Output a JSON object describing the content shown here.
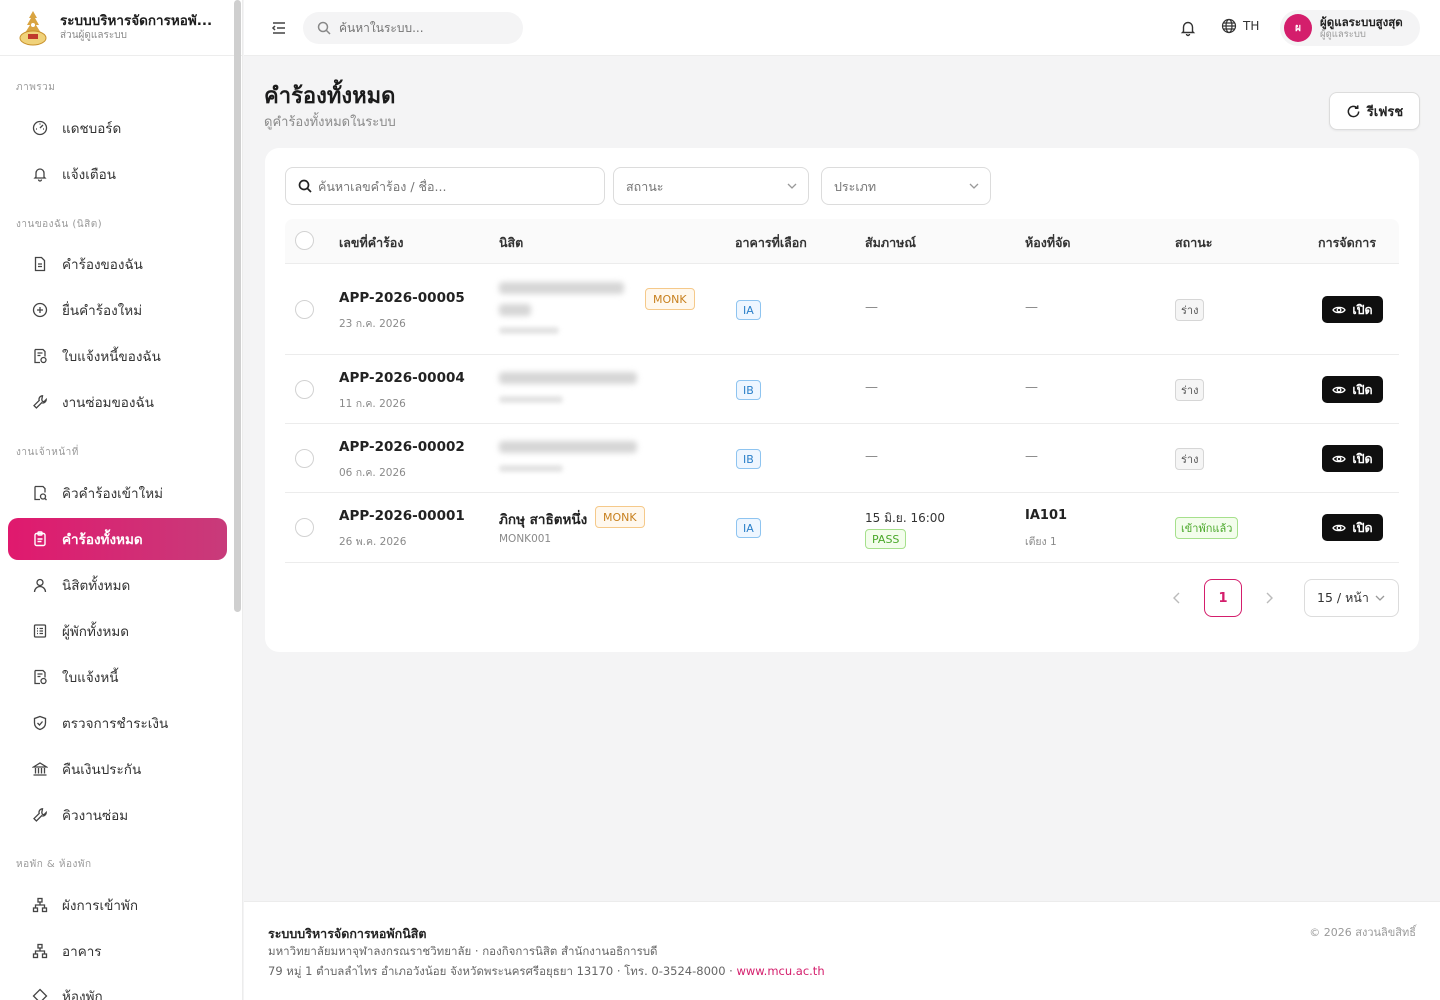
{
  "brand": {
    "title": "ระบบบริหารจัดการหอพั...",
    "subtitle": "ส่วนผู้ดูแลระบบ"
  },
  "sidebar": {
    "sections": [
      {
        "label": "ภาพรวม"
      },
      {
        "label": "งานของฉัน (นิสิต)"
      },
      {
        "label": "งานเจ้าหน้าที่"
      },
      {
        "label": "หอพัก & ห้องพัก"
      }
    ],
    "items": [
      {
        "label": "แดชบอร์ด",
        "icon": "dashboard-icon"
      },
      {
        "label": "แจ้งเตือน",
        "icon": "bell-icon"
      },
      {
        "label": "คำร้องของฉัน",
        "icon": "document-icon"
      },
      {
        "label": "ยื่นคำร้องใหม่",
        "icon": "plus-circle-icon"
      },
      {
        "label": "ใบแจ้งหนี้ของฉัน",
        "icon": "invoice-icon"
      },
      {
        "label": "งานซ่อมของฉัน",
        "icon": "wrench-icon"
      },
      {
        "label": "คิวคำร้องเข้าใหม่",
        "icon": "queue-icon"
      },
      {
        "label": "คำร้องทั้งหมด",
        "icon": "clipboard-icon",
        "active": true
      },
      {
        "label": "นิสิตทั้งหมด",
        "icon": "user-icon"
      },
      {
        "label": "ผู้พักทั้งหมด",
        "icon": "list-icon"
      },
      {
        "label": "ใบแจ้งหนี้",
        "icon": "invoice-icon"
      },
      {
        "label": "ตรวจการชำระเงิน",
        "icon": "shield-check-icon"
      },
      {
        "label": "คืนเงินประกัน",
        "icon": "bank-icon"
      },
      {
        "label": "คิวงานซ่อม",
        "icon": "wrench-icon"
      },
      {
        "label": "ผังการเข้าพัก",
        "icon": "sitemap-icon"
      },
      {
        "label": "อาคาร",
        "icon": "sitemap-icon"
      },
      {
        "label": "ห้องพัก",
        "icon": "room-icon"
      }
    ]
  },
  "topbar": {
    "search_placeholder": "ค้นหาในระบบ...",
    "lang": "TH",
    "user": {
      "initial": "ผ",
      "name": "ผู้ดูแลระบบสูงสุด",
      "role": "ผู้ดูแลระบบ"
    }
  },
  "page": {
    "title": "คำร้องทั้งหมด",
    "subtitle": "ดูคำร้องทั้งหมดในระบบ",
    "refresh_label": "รีเฟรช"
  },
  "filters": {
    "search_placeholder": "ค้นหาเลขคำร้อง / ชื่อ...",
    "status_placeholder": "สถานะ",
    "type_placeholder": "ประเภท"
  },
  "table": {
    "columns": [
      "เลขที่คำร้อง",
      "นิสิต",
      "อาคารที่เลือก",
      "สัมภาษณ์",
      "ห้องที่จัด",
      "สถานะ",
      "การจัดการ"
    ],
    "rows": [
      {
        "app_no": "APP-2026-00005",
        "date": "23 ก.ค. 2026",
        "name": "",
        "code": "",
        "tag": "MONK",
        "building": "IA",
        "interview": "—",
        "interview_result": "",
        "room": "—",
        "bed": "",
        "status": "ร่าง",
        "action": "เปิด"
      },
      {
        "app_no": "APP-2026-00004",
        "date": "11 ก.ค. 2026",
        "name": "",
        "code": "",
        "tag": "",
        "building": "IB",
        "interview": "—",
        "interview_result": "",
        "room": "—",
        "bed": "",
        "status": "ร่าง",
        "action": "เปิด"
      },
      {
        "app_no": "APP-2026-00002",
        "date": "06 ก.ค. 2026",
        "name": "",
        "code": "",
        "tag": "",
        "building": "IB",
        "interview": "—",
        "interview_result": "",
        "room": "—",
        "bed": "",
        "status": "ร่าง",
        "action": "เปิด"
      },
      {
        "app_no": "APP-2026-00001",
        "date": "26 พ.ค. 2026",
        "name": "ภิกษุ สาธิตหนึ่ง",
        "code": "MONK001",
        "tag": "MONK",
        "building": "IA",
        "interview": "15 มิ.ย. 16:00",
        "interview_result": "PASS",
        "room": "IA101",
        "bed": "เตียง 1",
        "status": "เข้าพักแล้ว",
        "action": "เปิด"
      }
    ]
  },
  "pagination": {
    "current": "1",
    "page_size": "15 / หน้า"
  },
  "footer": {
    "title": "ระบบบริหารจัดการหอพักนิสิต",
    "line1": "มหาวิทยาลัยมหาจุฬาลงกรณราชวิทยาลัย · กองกิจการนิสิต สำนักงานอธิการบดี",
    "line2": "79 หมู่ 1 ตำบลลำไทร อำเภอวังน้อย จังหวัดพระนครศรีอยุธยา 13170 · โทร. 0-3524-8000 ·",
    "link": "www.mcu.ac.th",
    "copyright": "© 2026 สงวนลิขสิทธิ์"
  },
  "colors": {
    "accent": "#d41e6c",
    "accent_gradient_end": "#c83b7a",
    "dark_button": "#0f0f0f"
  }
}
